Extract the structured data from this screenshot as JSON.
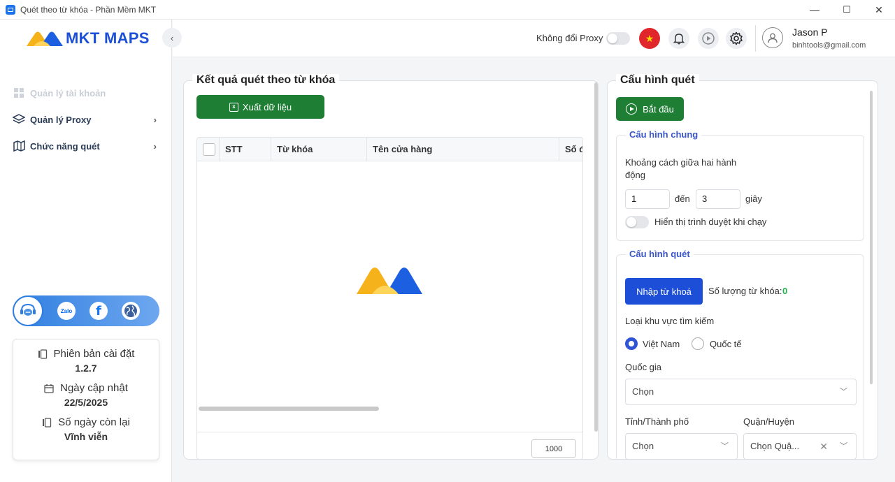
{
  "window": {
    "title": "Quét theo từ khóa - Phần Mềm MKT",
    "minimize": "—",
    "maximize": "☐",
    "close": "✕"
  },
  "sidebar": {
    "logo_text": "MKT MAPS",
    "items": [
      {
        "label": "Quản lý tài khoản",
        "icon": "grid-icon",
        "disabled": true
      },
      {
        "label": "Quản lý Proxy",
        "icon": "layers-icon",
        "disabled": false
      },
      {
        "label": "Chức năng quét",
        "icon": "map-icon",
        "disabled": false
      }
    ],
    "social": [
      "support-chat-icon",
      "zalo-icon",
      "facebook-icon",
      "globe-icon"
    ],
    "zalo_text": "Zalo",
    "facebook_text": "f",
    "info": {
      "version_label": "Phiên bản cài đặt",
      "version_value": "1.2.7",
      "updated_label": "Ngày cập nhật",
      "updated_value": "22/5/2025",
      "remaining_label": "Số ngày còn lại",
      "remaining_value": "Vĩnh viễn"
    }
  },
  "header": {
    "proxy_label": "Không đổi Proxy",
    "flag_glyph": "★",
    "user_name": "Jason P",
    "user_email": "binhtools@gmail.com"
  },
  "results": {
    "title": "Kết quả quét theo từ khóa",
    "export_label": "Xuất dữ liệu",
    "columns": [
      "STT",
      "Từ khóa",
      "Tên cửa hàng",
      "Số đ"
    ],
    "page_size": "1000"
  },
  "config": {
    "title": "Cấu hình quét",
    "start_label": "Bắt đầu",
    "general": {
      "title": "Cấu hình chung",
      "interval_label_1": "Khoảng cách giữa hai hành",
      "interval_label_2": "động",
      "from_value": "1",
      "to_label": "đến",
      "to_value": "3",
      "unit": "giây",
      "show_browser_label": "Hiển thị trình duyệt khi chạy"
    },
    "scan": {
      "title": "Cấu hình quét",
      "import_label": "Nhập từ khoá",
      "count_label": "Số lượng từ khóa:",
      "count_value": "0",
      "region_label": "Loại khu vực tìm kiếm",
      "region_options": [
        "Việt Nam",
        "Quốc tế"
      ],
      "country_label": "Quốc gia",
      "country_value": "Chọn",
      "province_label": "Tỉnh/Thành phố",
      "province_value": "Chọn",
      "district_label": "Quận/Huyện",
      "district_value": "Chọn Quậ..."
    }
  },
  "colors": {
    "brand_blue": "#1c4fd8",
    "green": "#1e7e34",
    "accent_blue": "#1d4ed8",
    "count_green": "#22b14c"
  }
}
